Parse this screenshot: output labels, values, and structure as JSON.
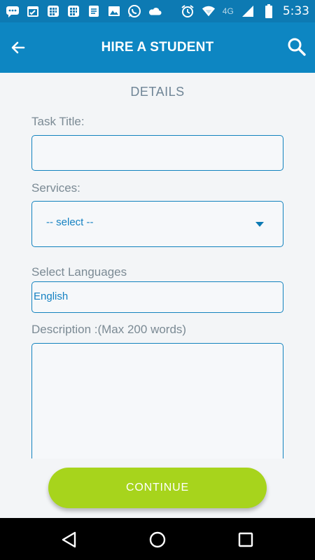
{
  "status_bar": {
    "time": "5:33",
    "network": "4G",
    "icons": [
      "chat-icon",
      "calendar-icon",
      "calculator-icon",
      "calculator-icon",
      "notes-icon",
      "image-icon",
      "whatsapp-icon",
      "cloud-icon",
      "alarm-icon",
      "wifi-icon",
      "signal-icon",
      "battery-icon"
    ]
  },
  "app_bar": {
    "title": "HIRE A STUDENT",
    "back_icon": "arrow-left-icon",
    "search_icon": "search-icon"
  },
  "form": {
    "section_title": "DETAILS",
    "task_title_label": "Task Title:",
    "task_title_value": "",
    "services_label": "Services:",
    "services_value": "-- select --",
    "languages_label": "Select Languages",
    "languages_value": "English",
    "description_label": "Description :(Max 200 words)",
    "description_value": ""
  },
  "actions": {
    "continue_label": "CONTINUE"
  },
  "colors": {
    "primary": "#0d86c2",
    "status_bar": "#0d7ab3",
    "accent_green": "#a7d41c",
    "field_border": "#1282be",
    "label_gray": "#7b8a94"
  }
}
